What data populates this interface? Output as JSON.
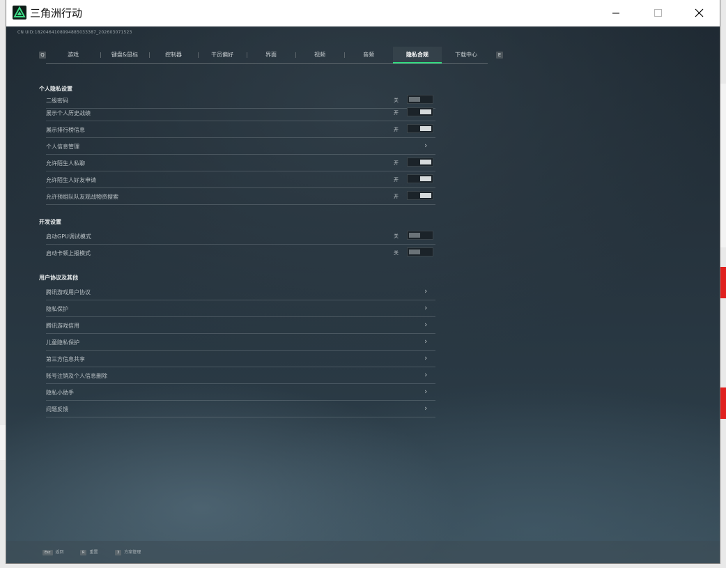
{
  "window": {
    "title": "三角洲行动"
  },
  "header": {
    "uid": "CN UID:1820464108994885033387_202603071523"
  },
  "tabs": {
    "items": [
      {
        "label": "游戏"
      },
      {
        "label": "键盘&鼠标"
      },
      {
        "label": "控制器"
      },
      {
        "label": "干员偏好"
      },
      {
        "label": "界面"
      },
      {
        "label": "视频"
      },
      {
        "label": "音频"
      },
      {
        "label": "隐私合规"
      },
      {
        "label": "下载中心"
      }
    ],
    "active_index": 7,
    "prev_key": "Q",
    "next_key": "E"
  },
  "personal": {
    "title": "个人隐私设置",
    "rows": [
      {
        "label": "二级密码",
        "state": "关"
      },
      {
        "label": "展示个人历史战绩",
        "state": "开"
      },
      {
        "label": "展示排行榜信息",
        "state": "开"
      },
      {
        "label": "个人信息管理"
      },
      {
        "label": "允许陌生人私聊",
        "state": "开"
      },
      {
        "label": "允许陌生人好友申请",
        "state": "开"
      },
      {
        "label": "允许预组队队友观战物资搜索",
        "state": "开"
      }
    ]
  },
  "dev": {
    "title": "开发设置",
    "rows": [
      {
        "label": "启动GPU调试模式",
        "state": "关"
      },
      {
        "label": "启动卡顿上报模式",
        "state": "关"
      }
    ]
  },
  "agreements": {
    "title": "用户协议及其他",
    "rows": [
      {
        "label": "腾讯游戏用户协议"
      },
      {
        "label": "隐私保护"
      },
      {
        "label": "腾讯游戏信用"
      },
      {
        "label": "儿童隐私保护"
      },
      {
        "label": "第三方信息共享"
      },
      {
        "label": "账号注销及个人信息删除"
      },
      {
        "label": "隐私小助手"
      },
      {
        "label": "问题反馈"
      }
    ]
  },
  "footer": {
    "hints": [
      {
        "key": "Esc",
        "label": "返回"
      },
      {
        "key": "R",
        "label": "重置"
      },
      {
        "key": "3",
        "label": "方案管理"
      }
    ]
  },
  "colors": {
    "accent": "#2fd97e"
  },
  "icons": {
    "app": "delta-force-logo-icon",
    "minimize": "minimize-icon",
    "maximize": "maximize-icon",
    "close": "close-icon",
    "chevron": "chevron-right-icon"
  }
}
